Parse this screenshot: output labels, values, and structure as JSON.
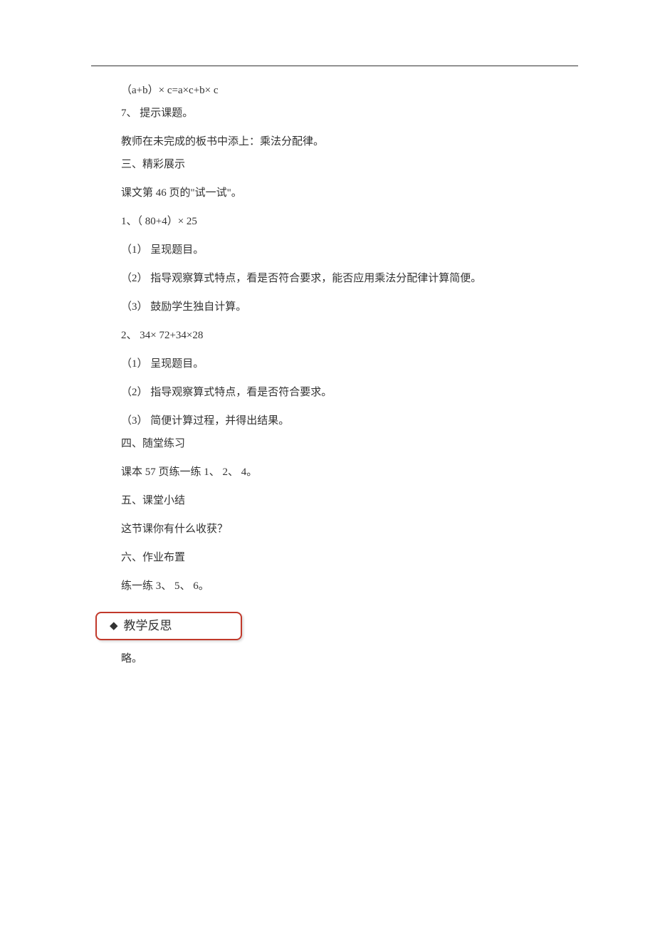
{
  "lines": {
    "l1": "（a+b）× c=a×c+b× c",
    "l2": "7、 提示课题。",
    "l3": "教师在未完成的板书中添上：乘法分配律。",
    "l4": "三、精彩展示",
    "l5": "课文第 46 页的\"试一试\"。",
    "l6": "1、（ 80+4）× 25",
    "l7": "（1） 呈现题目。",
    "l8": "（2） 指导观察算式特点，看是否符合要求，能否应用乘法分配律计算简便。",
    "l9": "（3） 鼓励学生独自计算。",
    "l10": "2、 34× 72+34×28",
    "l11": "（1） 呈现题目。",
    "l12": "（2） 指导观察算式特点，看是否符合要求。",
    "l13": "（3） 简便计算过程，并得出结果。",
    "l14": "四、随堂练习",
    "l15": "课本 57 页练一练 1、 2、 4。",
    "l16": "五、课堂小结",
    "l17": "这节课你有什么收获？",
    "l18": "六、作业布置",
    "l19": "练一练 3、 5、 6。"
  },
  "callout": {
    "diamond": "◆",
    "label": "教学反思"
  },
  "after": "略。"
}
